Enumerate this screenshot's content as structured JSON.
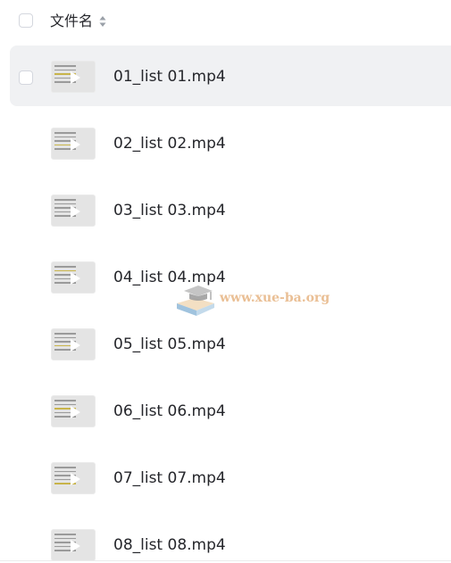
{
  "header": {
    "title": "文件名"
  },
  "files": [
    {
      "name": "01_list 01.mp4",
      "selected": true
    },
    {
      "name": "02_list 02.mp4",
      "selected": false
    },
    {
      "name": "03_list 03.mp4",
      "selected": false
    },
    {
      "name": "04_list 04.mp4",
      "selected": false
    },
    {
      "name": "05_list 05.mp4",
      "selected": false
    },
    {
      "name": "06_list 06.mp4",
      "selected": false
    },
    {
      "name": "07_list 07.mp4",
      "selected": false
    },
    {
      "name": "08_list 08.mp4",
      "selected": false
    }
  ],
  "watermark": {
    "text": "www.xue-ba.org"
  },
  "colors": {
    "selected_row_bg": "#f0f1f3",
    "text": "#25262b",
    "checkbox_border": "#d4d7de"
  }
}
